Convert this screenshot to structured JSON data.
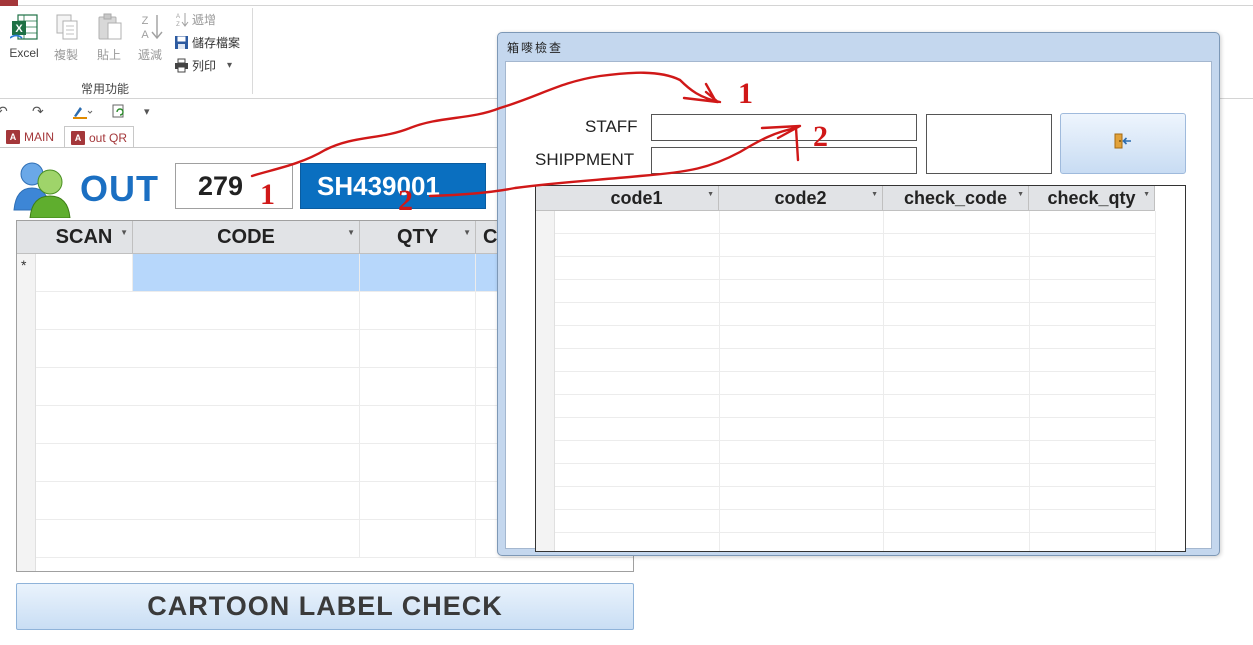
{
  "ribbon": {
    "excel_label": "Excel",
    "copy_label": "複製",
    "paste_label": "貼上",
    "sort_desc_label": "遞減",
    "sort_asc_label": "遞增",
    "save_label": "儲存檔案",
    "print_label": "列印",
    "print_dropdown": "▾",
    "group_label": "常用功能"
  },
  "quick_access": {
    "undo": "↶",
    "redo": "↷",
    "more": "▾"
  },
  "doc_tabs": [
    {
      "label": "MAIN",
      "icon": "access-icon",
      "active": false
    },
    {
      "label": "out QR",
      "icon": "access-icon",
      "active": true
    }
  ],
  "form": {
    "out_label": "OUT",
    "staff_value": "279",
    "shipment_value": "SH439001",
    "grid": {
      "columns": [
        "SCAN",
        "CODE",
        "QTY",
        "C"
      ],
      "new_row_marker": "*"
    },
    "check_button_label": "CARTOON LABEL CHECK"
  },
  "dialog": {
    "title": "箱嘜檢查",
    "staff_label": "STAFF",
    "shipment_label": "SHIPPMENT",
    "staff_value": "",
    "shipment_value": "",
    "exit_icon": "exit-door-icon",
    "grid": {
      "columns": [
        "code1",
        "code2",
        "check_code",
        "check_qty"
      ]
    }
  },
  "annotations": {
    "marker_1": "1",
    "marker_2": "2",
    "color": "#d01818"
  }
}
